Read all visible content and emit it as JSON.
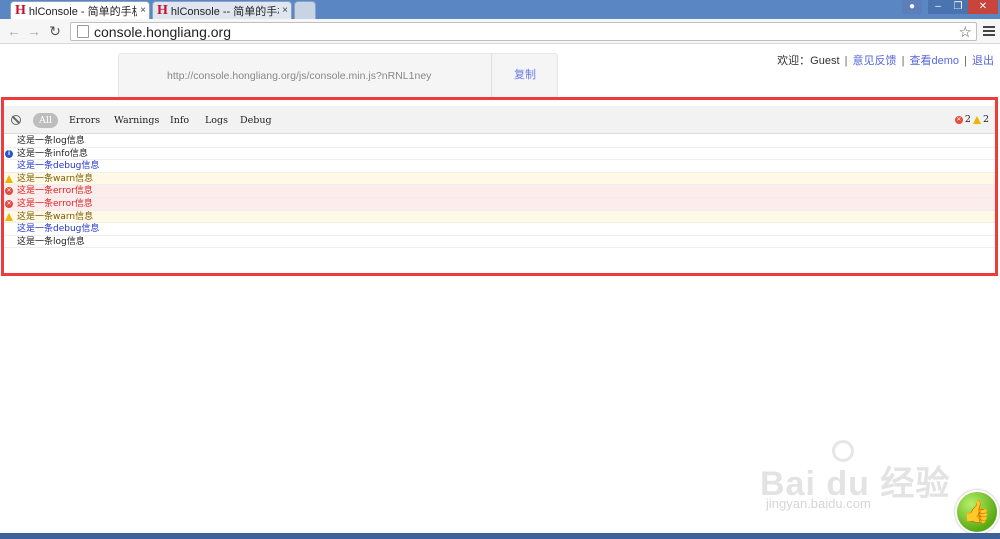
{
  "browser": {
    "tabs": [
      {
        "favicon": "H",
        "title": "hlConsole - 简单的手机/",
        "close": "×"
      },
      {
        "favicon": "H",
        "title": "hlConsole -- 简单的手机",
        "close": "×"
      }
    ],
    "url": "console.hongliang.org",
    "star_icon": "☆"
  },
  "userbar": {
    "welcome": "欢迎：Guest",
    "links": [
      "意见反馈",
      "查看demo",
      "退出"
    ]
  },
  "snippet": {
    "code": "http://console.hongliang.org/js/console.min.js?nRNL1ney",
    "copy_label": "复制"
  },
  "console": {
    "filters": [
      "All",
      "Errors",
      "Warnings",
      "Info",
      "Logs",
      "Debug"
    ],
    "active_filter": "All",
    "error_count": "2",
    "warn_count": "2",
    "rows": [
      {
        "level": "log",
        "text": "这是一条log信息"
      },
      {
        "level": "info",
        "text": "这是一条info信息"
      },
      {
        "level": "debug",
        "text": "这是一条debug信息"
      },
      {
        "level": "warn",
        "text": "这是一条warn信息"
      },
      {
        "level": "error",
        "text": "这是一条error信息"
      },
      {
        "level": "error",
        "text": "这是一条error信息"
      },
      {
        "level": "warn",
        "text": "这是一条warn信息"
      },
      {
        "level": "debug",
        "text": "这是一条debug信息"
      },
      {
        "level": "log",
        "text": "这是一条log信息"
      }
    ]
  },
  "watermark": {
    "brand": "Bai du 经验",
    "site": "jingyan.baidu.com"
  },
  "colors": {
    "highlight": "#ee3b3b",
    "link": "#5566dd",
    "error": "#dd2222",
    "debug": "#2233cc",
    "warn_bg": "#fff9e6",
    "error_bg": "#fdecec"
  }
}
